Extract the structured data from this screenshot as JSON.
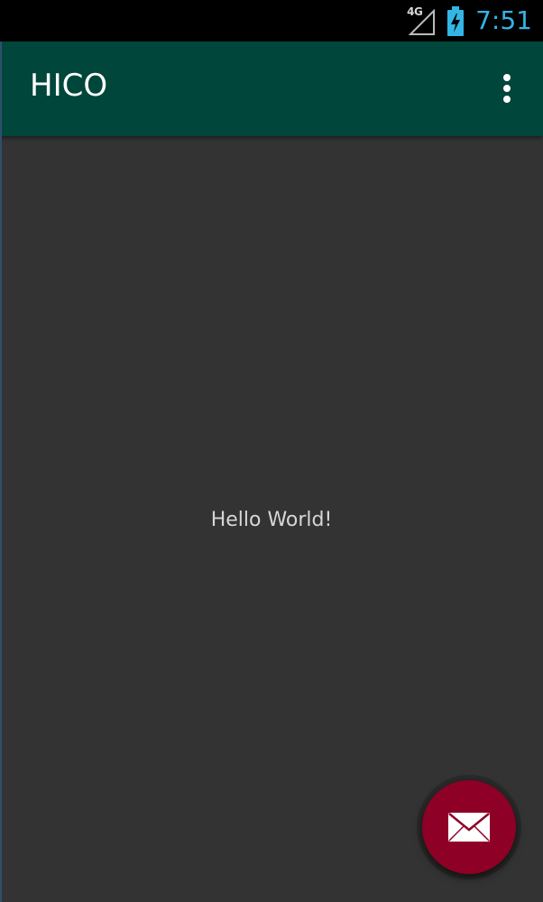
{
  "status_bar": {
    "network_type": "4G",
    "time": "7:51",
    "signal_icon": "signal-strength-icon",
    "battery_icon": "battery-charging-icon"
  },
  "app_bar": {
    "title": "HICO",
    "menu_icon": "overflow-menu-icon"
  },
  "main": {
    "message": "Hello World!"
  },
  "fab": {
    "icon": "mail-icon"
  },
  "colors": {
    "app_bar": "#00463b",
    "content_background": "#333333",
    "fab": "#8e0025",
    "clock": "#33b5e5"
  }
}
